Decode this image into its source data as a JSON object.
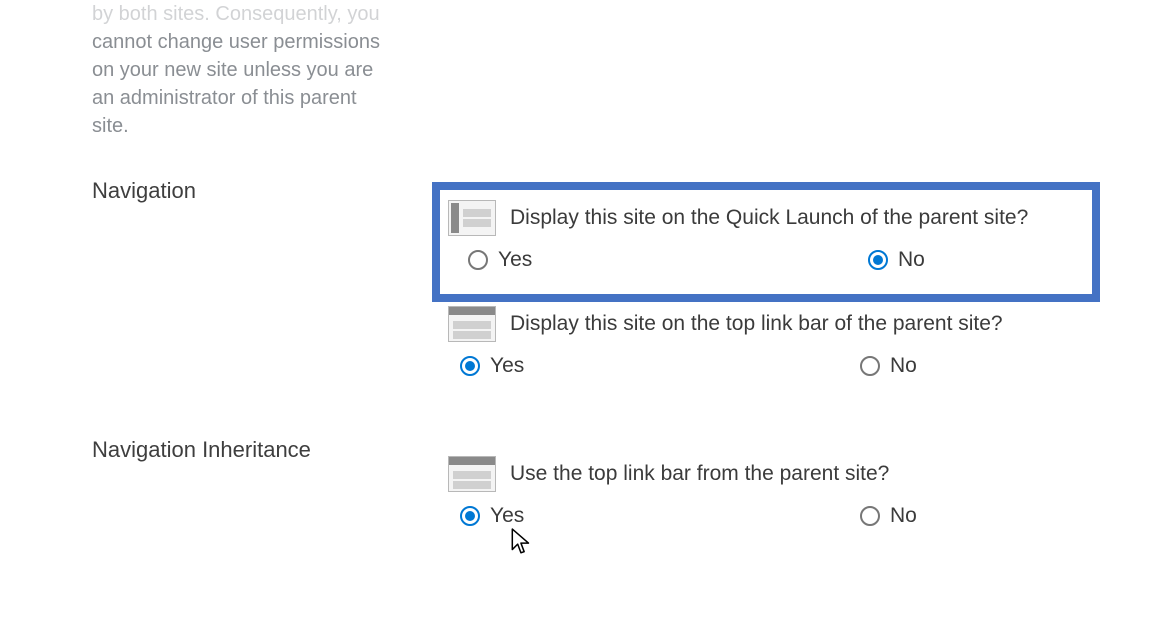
{
  "permissions": {
    "line0": "by both sites. Consequently, you",
    "line1": "cannot change user permissions",
    "line2": "on your new site unless you are",
    "line3": "an administrator of this parent",
    "line4": "site."
  },
  "navigation": {
    "heading": "Navigation",
    "quick_launch_label": "Display this site on the Quick Launch of the parent site?",
    "top_link_label": "Display this site on the top link bar of the parent site?"
  },
  "nav_inherit": {
    "heading": "Navigation Inheritance",
    "inherit_label": "Use the top link bar from the parent site?"
  },
  "radio": {
    "yes": "Yes",
    "no": "No"
  },
  "colors": {
    "highlight": "#4472c4",
    "accent": "#0078d4"
  }
}
